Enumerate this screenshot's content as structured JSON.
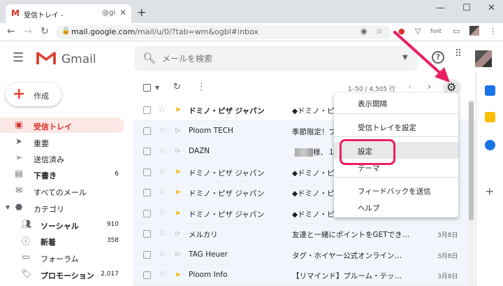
{
  "browser": {
    "tab_title": "受信トレイ - ",
    "tab_title_2": "@gi",
    "url_host": "mail.google.com",
    "url_path": "/mail/u/0/?tab=wm&ogbl#inbox",
    "ext_font_label": "font"
  },
  "app": {
    "name": "Gmail",
    "search_placeholder": "メールを検索",
    "compose_label": "作成"
  },
  "sidebar": [
    {
      "label": "受信トレイ",
      "icon": "inbox-icon",
      "count": "",
      "active": true
    },
    {
      "label": "重要",
      "icon": "label-important-icon",
      "count": ""
    },
    {
      "label": "送信済み",
      "icon": "send-icon",
      "count": ""
    },
    {
      "label": "下書き",
      "icon": "draft-icon",
      "count": "6",
      "bold": true
    },
    {
      "label": "すべてのメール",
      "icon": "all-mail-icon",
      "count": ""
    },
    {
      "label": "カテゴリ",
      "icon": "category-icon",
      "count": ""
    },
    {
      "label": "ソーシャル",
      "icon": "people-icon",
      "count": "910",
      "bold": true,
      "sub": true
    },
    {
      "label": "新着",
      "icon": "info-icon",
      "count": "358",
      "bold": true,
      "sub": true
    },
    {
      "label": "フォーラム",
      "icon": "forum-icon",
      "count": "",
      "sub": true
    },
    {
      "label": "プロモーション",
      "icon": "tag-icon",
      "count": "2,017",
      "bold": true,
      "sub": true
    }
  ],
  "toolbar": {
    "page_info": "1–50 / 4,505 行"
  },
  "emails": [
    {
      "sender": "ドミノ・ピザ ジャパン",
      "subject": "◆ドミノ・ピ",
      "date": "",
      "important": true,
      "unread": true
    },
    {
      "sender": "Ploom TECH",
      "subject": "季節限定！ブ",
      "date": "",
      "important": false,
      "unread": false
    },
    {
      "sender": "DAZN",
      "subject": "様、１",
      "date": "",
      "important": false,
      "unread": false,
      "blur": true
    },
    {
      "sender": "ドミノ・ピザ ジャパン",
      "subject": "◆ドミノ・ピ",
      "date": "",
      "important": true,
      "unread": false
    },
    {
      "sender": "ドミノ・ピザ ジャパン",
      "subject": "◆ドミノ・ピ",
      "date": "",
      "important": true,
      "unread": false
    },
    {
      "sender": "ドミノ・ピザ ジャパン",
      "subject": "◆ドミノ・ピ",
      "date": "",
      "important": true,
      "unread": false
    },
    {
      "sender": "メルカリ",
      "subject": "友達と一緒にポイントをGETでき…",
      "date": "3月8日",
      "important": false,
      "unread": false
    },
    {
      "sender": "TAG Heuer",
      "subject": "タグ・ホイヤー公式オンライン…",
      "date": "3月8日",
      "important": false,
      "unread": false
    },
    {
      "sender": "Ploom Info",
      "subject": "【リマインド】プルーム・テッ…",
      "date": "3月8日",
      "important": true,
      "unread": false
    }
  ],
  "settings_menu": [
    {
      "label": "表示間隔"
    },
    {
      "label": "受信トレイを設定"
    },
    {
      "label": "設定",
      "highlighted": true
    },
    {
      "label": "テーマ"
    },
    {
      "label": "フィードバックを送信"
    },
    {
      "label": "ヘルプ"
    }
  ],
  "colors": {
    "accent": "#d93025",
    "annotation": "#e91e63",
    "importance": "#f4b400"
  }
}
